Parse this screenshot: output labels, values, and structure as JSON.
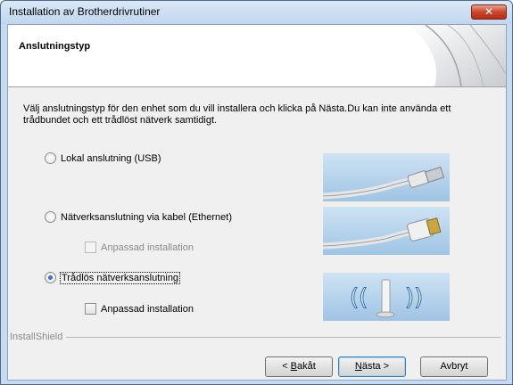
{
  "window": {
    "title": "Installation av Brotherdrivrutiner",
    "close_glyph": "✕"
  },
  "header": {
    "title": "Anslutningstyp"
  },
  "intro": "Välj anslutningstyp för den enhet som du vill installera och klicka på Nästa.Du kan inte använda ett trådbundet och ett trådlöst nätverk samtidigt.",
  "options": {
    "usb": {
      "label": "Lokal anslutning (USB)",
      "selected": false
    },
    "ethernet": {
      "label": "Nätverksanslutning via kabel (Ethernet)",
      "selected": false
    },
    "ethernet_custom": {
      "label": "Anpassad installation",
      "enabled": false,
      "checked": false
    },
    "wireless": {
      "label": "Trådlös nätverksanslutning",
      "selected": true
    },
    "wireless_custom": {
      "label": "Anpassad installation",
      "enabled": true,
      "checked": false
    }
  },
  "footer": {
    "brand": "InstallShield",
    "back_prefix": "< ",
    "back_accel": "B",
    "back_rest": "akåt",
    "next_accel": "N",
    "next_rest": "ästa >",
    "cancel_label": "Avbryt"
  },
  "icons": {
    "usb": "usb-cable-image",
    "ethernet": "ethernet-cable-image",
    "wireless": "wireless-router-image"
  },
  "colors": {
    "titlebar": "#c6dbef",
    "accent": "#3c7fb1",
    "close": "#c9462c"
  }
}
